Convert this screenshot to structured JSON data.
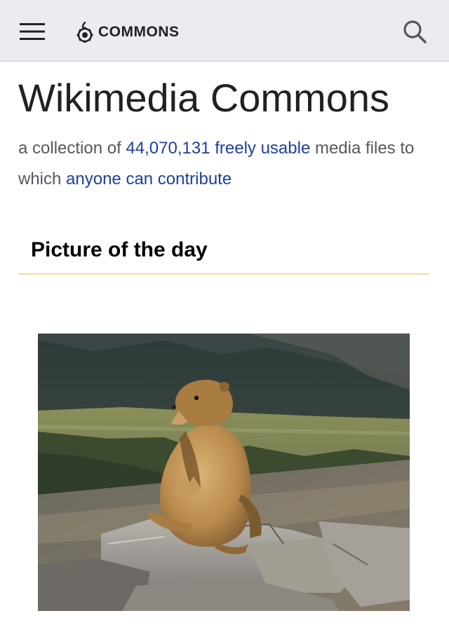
{
  "header": {
    "logo_text": "COMMONS",
    "menu_icon": "hamburger-menu-icon",
    "search_icon": "search-icon",
    "background": "#eaecf0"
  },
  "main": {
    "title": "Wikimedia Commons",
    "tagline": {
      "prefix": "a collection of ",
      "count": "44,070,131",
      "middle": " ",
      "link_freely": "freely usable",
      "suffix1": " media files to which ",
      "link_contribute": "anyone can contribute"
    },
    "link_color": "#1f3f9e"
  },
  "picture_of_the_day": {
    "heading": "Picture of the day",
    "rule_color": "#f0dd9e"
  }
}
